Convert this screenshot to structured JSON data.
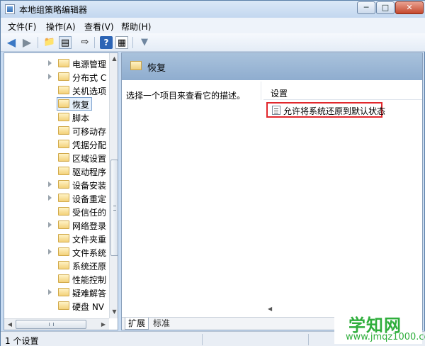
{
  "window": {
    "title": "本地组策略编辑器",
    "min_glyph": "─",
    "max_glyph": "□",
    "close_glyph": "✕"
  },
  "menu": [
    "文件(F)",
    "操作(A)",
    "查看(V)",
    "帮助(H)"
  ],
  "toolbar_icons": {
    "back": "◀",
    "forward": "▶",
    "up": "📁",
    "showhide": "▤",
    "export": "⇨",
    "help": "?",
    "properties": "▦",
    "filter": "▼"
  },
  "tree": {
    "items": [
      {
        "label": "电源管理",
        "expandable": true
      },
      {
        "label": "分布式 C",
        "expandable": true
      },
      {
        "label": "关机选项",
        "expandable": false
      },
      {
        "label": "恢复",
        "expandable": false,
        "selected": true
      },
      {
        "label": "脚本",
        "expandable": false
      },
      {
        "label": "可移动存",
        "expandable": false
      },
      {
        "label": "凭据分配",
        "expandable": false
      },
      {
        "label": "区域设置",
        "expandable": false
      },
      {
        "label": "驱动程序",
        "expandable": false
      },
      {
        "label": "设备安装",
        "expandable": true
      },
      {
        "label": "设备重定",
        "expandable": true
      },
      {
        "label": "受信任的",
        "expandable": false
      },
      {
        "label": "网络登录",
        "expandable": true
      },
      {
        "label": "文件夹重",
        "expandable": false
      },
      {
        "label": "文件系统",
        "expandable": true
      },
      {
        "label": "系统还原",
        "expandable": false
      },
      {
        "label": "性能控制",
        "expandable": false
      },
      {
        "label": "疑难解答",
        "expandable": true
      },
      {
        "label": "硬盘 NV",
        "expandable": false
      }
    ]
  },
  "detail": {
    "header_title": "恢复",
    "description": "选择一个项目来查看它的描述。",
    "column_header": "设置",
    "settings": [
      "允许将系统还原到默认状态"
    ]
  },
  "tabs": {
    "extended": "扩展",
    "standard": "标准"
  },
  "status": {
    "text": "1 个设置"
  },
  "watermark": {
    "title": "学知网",
    "url": "www.jmqz1000.com"
  }
}
